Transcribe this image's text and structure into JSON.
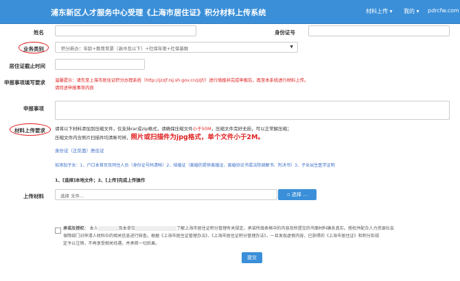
{
  "header": {
    "title": "浦东新区人才服务中心受理《上海市居住证》积分材料上传系统",
    "nav_materials": "材料上传",
    "nav_mine": "我的",
    "nav_user": "pdrcfw.com"
  },
  "form": {
    "name_label": "姓名",
    "idcard_label": "身份证号",
    "business_label": "业务类别",
    "business_value": "积分新办：年龄+教育背景（高中及以下）+社保年限+社保基数",
    "deadline_label": "居住证截止时间",
    "requirements_label": "申报事项填写要求",
    "requirements_hint_1": "温馨提示：请先至上海市居住证积分办理系统（http://jzzjf.rsj.sh.gov.cn/jzjf/）进行填报并完成申报后，再至本系统进行材料上传。",
    "requirements_hint_2": "请同述申报事项内容",
    "matters_label": "申报事项",
    "upload_req_label": "材料上传要求",
    "upload_req_line1_a": "请将以下材料添加到压缩文件，仅支持rar或zip格式，请确保压缩文件",
    "upload_req_line1_b": "小于50M",
    "upload_req_line1_c": "，压缩文件完好无损，可以正常解压缩；",
    "upload_req_line2_a": "压缩文件内含照片扫描件均清晰可辨，",
    "upload_req_line2_b": "照片或扫描件为jpg格式，单个文件小于2M。",
    "doc_list_1": "身份证（正反面）居住证",
    "doc_list_2": "如添加子女：1、户口本首页及同住人员（身份证号码清晰）2、结婚证（离婚的提供离婚证、离婚协议书或法院调解书、判决书）3、子女出生医学证明",
    "upload_steps": "1、[选择]本地文件；2、[上传]完成上传操作",
    "upload_label": "上传材料",
    "upload_placeholder": "选择 文件...",
    "select_button": "▫ 选择 ...",
    "promise_title": "承诺及授权：",
    "promise_text_1": "本人",
    "promise_text_2": "及本单位",
    "promise_text_3": "了解上海市居住证积分管理有关规定，承诺所填表格中的内容及所提交的书面材料确系真实。授权并配合人力资源社会",
    "promise_text_4": "保障部门对申请人材料中的相关信息进行核查。根据《上海市居住证管理办法》、《上海市居住证积分管理办法》，一旦发现虚假内容，已获得的《上海市居住证》和积分拆规",
    "promise_text_5": "定予以注销，不再享受相关待遇，并承担一切后果。",
    "submit_label": "提交"
  },
  "colors": {
    "header": "#3a8fd8",
    "accent_red": "#e02020",
    "link_blue": "#3a6ec9"
  }
}
